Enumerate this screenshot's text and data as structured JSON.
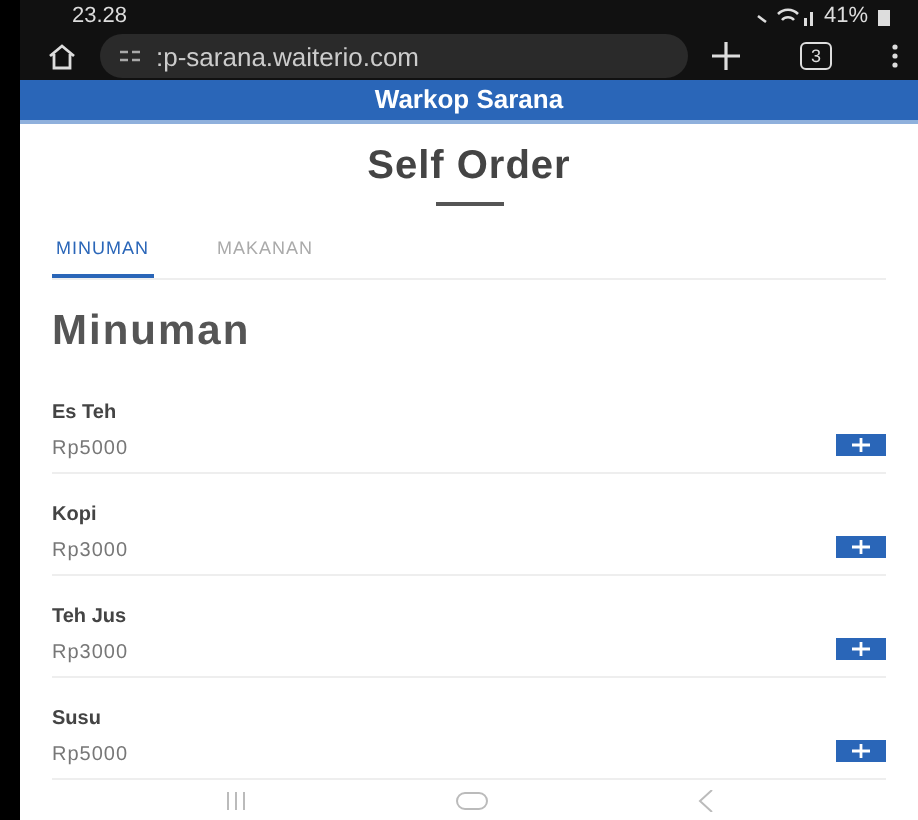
{
  "status_bar": {
    "time": "23.28",
    "battery": "41%"
  },
  "browser": {
    "url": ":p-sarana.waiterio.com",
    "tab_count": "3"
  },
  "header": {
    "title": "Warkop Sarana"
  },
  "page_title": "Self Order",
  "tabs": [
    {
      "label": "MINUMAN",
      "selected": true
    },
    {
      "label": "MAKANAN",
      "selected": false
    }
  ],
  "section_title": "Minuman",
  "items": [
    {
      "name": "Es Teh",
      "price": "Rp5000"
    },
    {
      "name": "Kopi",
      "price": "Rp3000"
    },
    {
      "name": "Teh Jus",
      "price": "Rp3000"
    },
    {
      "name": "Susu",
      "price": "Rp5000"
    }
  ]
}
